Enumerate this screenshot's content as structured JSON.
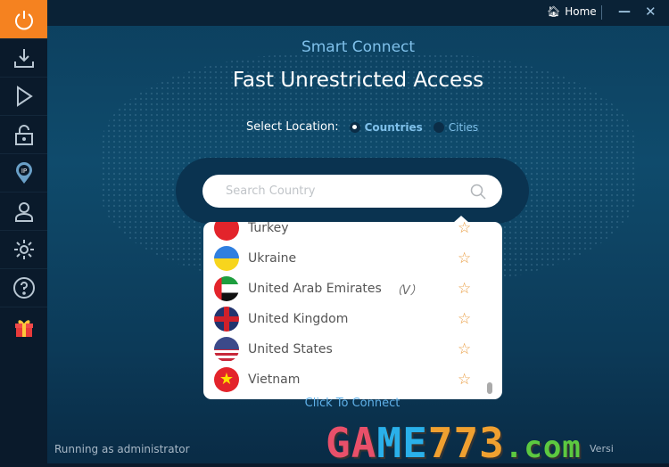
{
  "titlebar": {
    "home_label": "Home",
    "minimize": "—",
    "close": "✕"
  },
  "sidebar": {
    "items": [
      {
        "icon": "power-icon",
        "active": true
      },
      {
        "icon": "download-icon"
      },
      {
        "icon": "play-icon"
      },
      {
        "icon": "lock-icon"
      },
      {
        "icon": "ip-location-icon"
      },
      {
        "icon": "user-icon"
      },
      {
        "icon": "gear-icon"
      },
      {
        "icon": "help-icon"
      },
      {
        "icon": "gift-icon"
      }
    ]
  },
  "main": {
    "subtitle": "Smart Connect",
    "title": "Fast Unrestricted Access",
    "select_location_label": "Select Location:",
    "options": [
      {
        "label": "Countries",
        "selected": true
      },
      {
        "label": "Cities",
        "selected": false
      }
    ],
    "search": {
      "placeholder": "Search Country"
    },
    "countries": [
      {
        "name": "Turkey"
      },
      {
        "name": "Ukraine"
      },
      {
        "name": "United Arab Emirates",
        "tag": "（V）"
      },
      {
        "name": "United Kingdom"
      },
      {
        "name": "United States"
      },
      {
        "name": "Vietnam"
      }
    ],
    "connect_label": "Click To Connect"
  },
  "status": {
    "running": "Running as administrator",
    "version": "Versi"
  },
  "watermark": "GAME773.com",
  "colors": {
    "accent": "#f58220",
    "link": "#5fb0e8",
    "star": "#e99a3c"
  }
}
